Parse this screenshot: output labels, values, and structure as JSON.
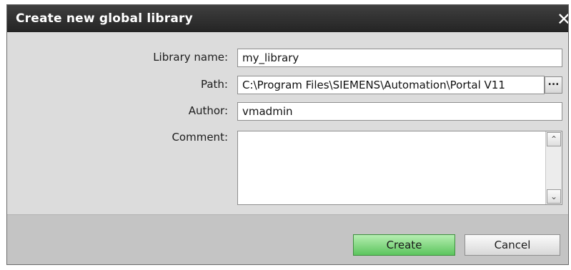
{
  "dialog": {
    "title": "Create new global library",
    "close_glyph": "✕"
  },
  "form": {
    "library_name": {
      "label": "Library name:",
      "value": "my_library"
    },
    "path": {
      "label": "Path:",
      "value": "C:\\Program Files\\SIEMENS\\Automation\\Portal V11",
      "browse_label": "..."
    },
    "author": {
      "label": "Author:",
      "value": "vmadmin"
    },
    "comment": {
      "label": "Comment:",
      "value": ""
    }
  },
  "scroll": {
    "up_glyph": "⌃",
    "down_glyph": "⌄"
  },
  "buttons": {
    "create": "Create",
    "cancel": "Cancel"
  },
  "colors": {
    "title_bar": "#2f2f2f",
    "create_button": "#7ed67a",
    "dialog_bg": "#dcdcdc",
    "footer_bg": "#c4c4c4"
  }
}
